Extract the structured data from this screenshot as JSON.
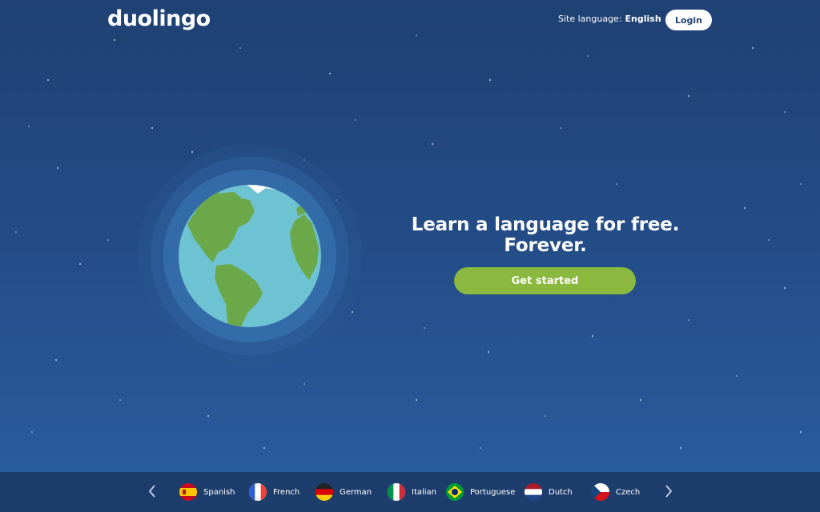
{
  "header": {
    "logo_text": "duolingo",
    "site_language_label": "Site language:",
    "site_language_value": "English",
    "login_label": "Login"
  },
  "hero": {
    "headline": "Learn a language for free. Forever.",
    "cta_label": "Get started"
  },
  "languages": [
    {
      "name": "Spanish",
      "flag": "es-flag-icon"
    },
    {
      "name": "French",
      "flag": "fr-flag-icon"
    },
    {
      "name": "German",
      "flag": "de-flag-icon"
    },
    {
      "name": "Italian",
      "flag": "it-flag-icon"
    },
    {
      "name": "Portuguese",
      "flag": "br-flag-icon"
    },
    {
      "name": "Dutch",
      "flag": "nl-flag-icon"
    },
    {
      "name": "Czech",
      "flag": "cz-flag-icon"
    }
  ],
  "colors": {
    "background_top": "#1f4173",
    "background_bottom": "#2a5ea2",
    "cta": "#8bb83f",
    "ocean": "#6ec3d2",
    "land": "#6ba84a",
    "language_bar": "#1d3e6c"
  }
}
